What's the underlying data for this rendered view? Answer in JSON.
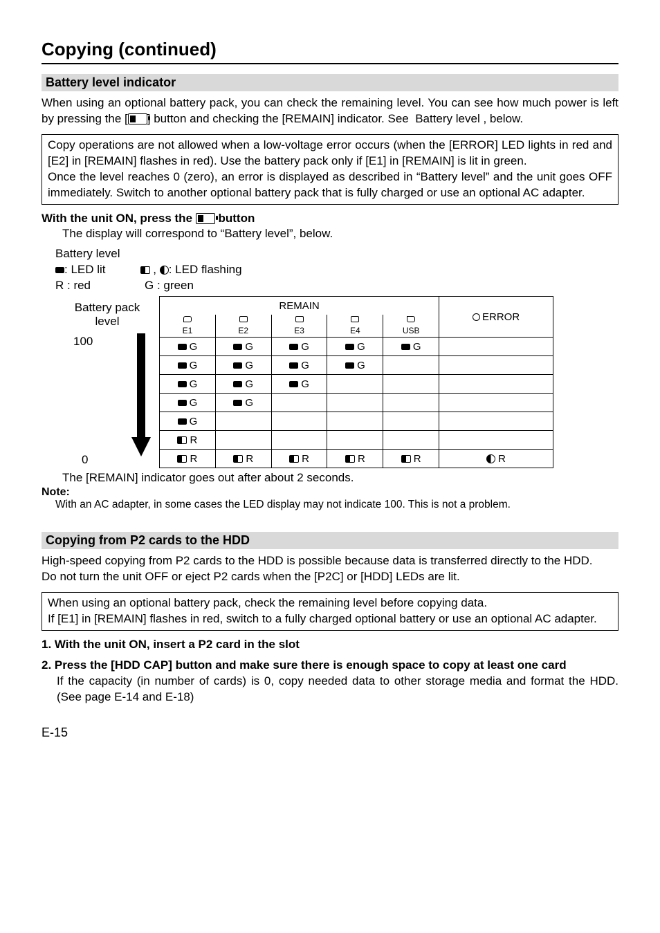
{
  "page_title": "Copying (continued)",
  "section1": {
    "heading": "Battery level indicator",
    "para": "When using an optional battery pack, you can check the remaining level. You can see how much power is left by pressing the [    ] button and checking the [REMAIN] indicator. See “Battery level”, below.",
    "box_p1": "Copy operations are not allowed when a low-voltage error occurs (when the [ERROR] LED lights in red and [E2] in [REMAIN] flashes in red). Use the battery pack only if [E1] in [REMAIN] is lit in green.",
    "box_p2": "Once the level reaches 0 (zero), an error is displayed as described in “Battery level” and the unit goes OFF immediately. Switch to another optional battery pack that is fully charged or use an optional AC adapter.",
    "step_heading_pre": "With the unit ON, press the ",
    "step_heading_post": " button",
    "step_sub": "The display will correspond to “Battery level”, below.",
    "legend_title": "Battery level",
    "legend_lit": " : LED lit",
    "legend_flash": " : LED flashing",
    "legend_r": "R : red",
    "legend_g": "G    : green",
    "left_head1": "Battery pack",
    "left_head2": "level",
    "lvl_top": "100",
    "lvl_bot": "0",
    "table_caption": "The [REMAIN] indicator goes out after about 2 seconds.",
    "note_label": "Note:",
    "note_text": "With an AC adapter, in some cases the LED display may not indicate 100. This is not a problem."
  },
  "chart_data": {
    "type": "table",
    "title": "Battery level LED state (REMAIN)",
    "remain_header": "REMAIN",
    "columns": [
      "E1",
      "E2",
      "E3",
      "E4",
      "USB",
      "ERROR"
    ],
    "legend": {
      "G": "green LED lit",
      "Rf": "red LED flashing (square)",
      "Rc": "red LED flashing (circle)"
    },
    "rows": [
      {
        "cells": [
          "G",
          "G",
          "G",
          "G",
          "G",
          ""
        ]
      },
      {
        "cells": [
          "G",
          "G",
          "G",
          "G",
          "",
          ""
        ]
      },
      {
        "cells": [
          "G",
          "G",
          "G",
          "",
          "",
          ""
        ]
      },
      {
        "cells": [
          "G",
          "G",
          "",
          "",
          "",
          ""
        ]
      },
      {
        "cells": [
          "G",
          "",
          "",
          "",
          "",
          ""
        ]
      },
      {
        "cells": [
          "Rf",
          "",
          "",
          "",
          "",
          ""
        ]
      },
      {
        "cells": [
          "Rf",
          "Rf",
          "Rf",
          "Rf",
          "Rf",
          "Rc"
        ]
      }
    ]
  },
  "section2": {
    "heading": "Copying from P2 cards to the HDD",
    "para1": "High-speed copying from P2 cards to the HDD is possible because data is transferred directly to the HDD.",
    "para2": "Do not turn the unit OFF or eject P2 cards when the [P2C] or [HDD] LEDs are lit.",
    "box_p1": "When using an optional battery pack, check the remaining level before copying data.",
    "box_p2": "If [E1] in [REMAIN] flashes in red, switch to a fully charged optional battery or use an optional AC adapter.",
    "step1": "1. With the unit ON, insert a P2 card in the slot",
    "step2_head": "2. Press the [HDD CAP] button and make sure there is enough space to copy at least one card",
    "step2_body": "If the capacity (in number of cards) is 0, copy needed data to other storage media and format the HDD. (See page E-14 and E-18)"
  },
  "page_number": "E-15"
}
